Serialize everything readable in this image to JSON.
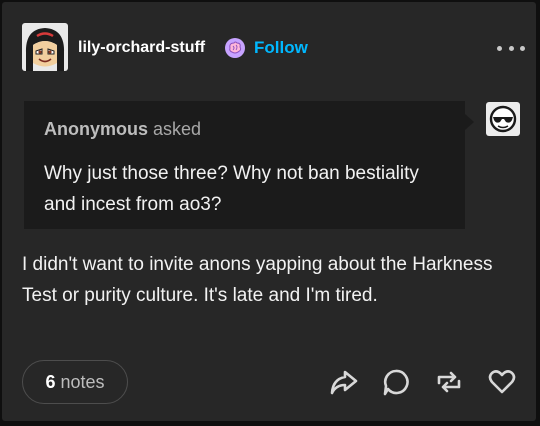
{
  "post": {
    "blog_name": "lily-orchard-stuff",
    "follow_label": "Follow",
    "ask": {
      "asker": "Anonymous",
      "verb": "asked",
      "question": "Why just those three? Why not ban bestiality and incest from ao3?"
    },
    "answer": "I didn't want to invite anons yapping about the Harkness Test or purity culture. It's late and I'm tired.",
    "notes": {
      "count": "6",
      "label": "notes"
    },
    "icons": {
      "avatar": "blog-avatar",
      "badge": "brain-badge-icon",
      "more": "more-options-icon",
      "anon_avatar": "anonymous-sunglasses-icon",
      "share": "share-icon",
      "reply": "reply-icon",
      "reblog": "reblog-icon",
      "like": "heart-icon"
    },
    "colors": {
      "accent": "#00b8ff",
      "card": "#272727",
      "ask_background": "#1b1b1b"
    }
  }
}
